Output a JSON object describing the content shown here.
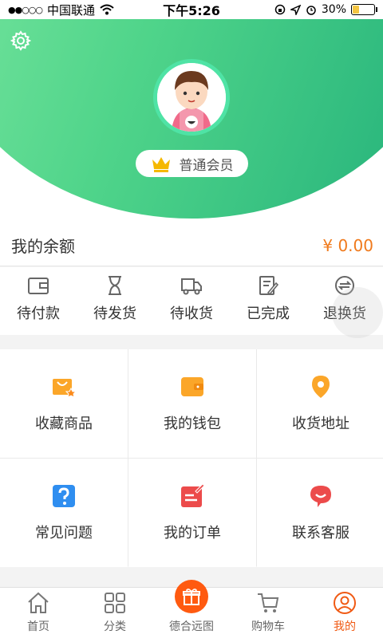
{
  "status_bar": {
    "carrier": "中国联通",
    "time": "下午5:26",
    "battery": "30%",
    "battery_level": 0.3
  },
  "header": {
    "member_level": "普通会员"
  },
  "balance": {
    "label": "我的余额",
    "value": "¥ 0.00"
  },
  "orders": [
    {
      "label": "待付款",
      "icon": "wallet-icon"
    },
    {
      "label": "待发货",
      "icon": "hourglass-icon"
    },
    {
      "label": "待收货",
      "icon": "truck-icon"
    },
    {
      "label": "已完成",
      "icon": "edit-doc-icon"
    },
    {
      "label": "退换货",
      "icon": "exchange-icon"
    }
  ],
  "grid": [
    {
      "label": "收藏商品",
      "icon": "favorite-bag-icon"
    },
    {
      "label": "我的钱包",
      "icon": "wallet-icon"
    },
    {
      "label": "收货地址",
      "icon": "location-pin-icon"
    },
    {
      "label": "常见问题",
      "icon": "question-icon"
    },
    {
      "label": "我的订单",
      "icon": "order-icon"
    },
    {
      "label": "联系客服",
      "icon": "chat-icon"
    }
  ],
  "tabbar": [
    {
      "label": "首页",
      "icon": "home-icon"
    },
    {
      "label": "分类",
      "icon": "category-icon"
    },
    {
      "label": "德合远图",
      "icon": "gift-icon"
    },
    {
      "label": "购物车",
      "icon": "cart-icon"
    },
    {
      "label": "我的",
      "icon": "user-icon",
      "active": true
    }
  ],
  "colors": {
    "accent": "#f07a1c",
    "active_tab": "#f05a14",
    "header_start": "#7ee8a2",
    "header_end": "#22b07a"
  }
}
